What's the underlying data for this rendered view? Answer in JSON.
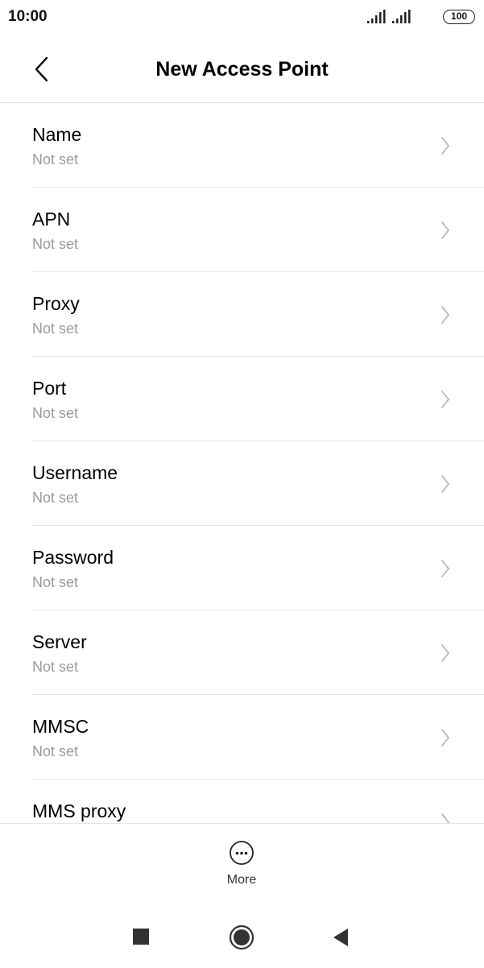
{
  "status_bar": {
    "time": "10:00",
    "battery": "100",
    "icons": [
      "signal-icon",
      "signal-icon",
      "battery-icon"
    ]
  },
  "app_bar": {
    "title": "New Access Point",
    "back_icon": "back-chevron-icon"
  },
  "fields": [
    {
      "label": "Name",
      "value": "Not set"
    },
    {
      "label": "APN",
      "value": "Not set"
    },
    {
      "label": "Proxy",
      "value": "Not set"
    },
    {
      "label": "Port",
      "value": "Not set"
    },
    {
      "label": "Username",
      "value": "Not set"
    },
    {
      "label": "Password",
      "value": "Not set"
    },
    {
      "label": "Server",
      "value": "Not set"
    },
    {
      "label": "MMSC",
      "value": "Not set"
    },
    {
      "label": "MMS proxy"
    }
  ],
  "bottom_bar": {
    "more_label": "More",
    "more_icon": "more-dots-icon"
  },
  "nav_bar": {
    "icons": [
      "recents-square-icon",
      "home-circle-icon",
      "back-triangle-icon"
    ]
  },
  "colors": {
    "primary_text": "#000000",
    "secondary_text": "#9a9a9a",
    "chevron": "#b8b8b8",
    "divider": "#e6e6e6",
    "nav_icons": "#333333"
  }
}
